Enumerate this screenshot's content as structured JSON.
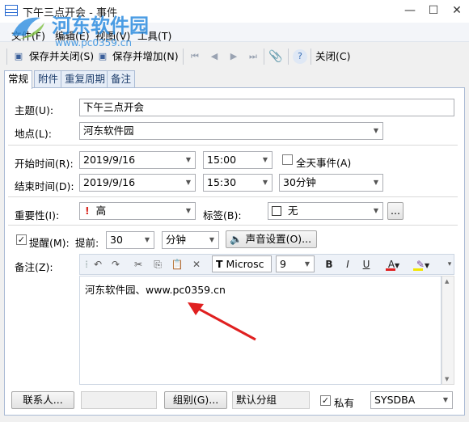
{
  "window": {
    "title": "下午三点开会 - 事件",
    "minimize": "—",
    "maximize": "☐",
    "close": "✕"
  },
  "watermark": {
    "text": "河东软件园",
    "url": "www.pc0359.cn"
  },
  "menu": [
    "文件(F)",
    "编辑(E)",
    "视图(V)",
    "工具(T)"
  ],
  "toolbar": {
    "save_close": "保存并关闭(S)",
    "save_add": "保存并增加(N)",
    "close": "关闭(C)"
  },
  "tabs": [
    "常规",
    "附件",
    "重复周期",
    "备注"
  ],
  "form": {
    "subject_label": "主题(U):",
    "subject_value": "下午三点开会",
    "location_label": "地点(L):",
    "location_value": "河东软件园",
    "start_label": "开始时间(R):",
    "start_date": "2019/9/16",
    "start_time": "15:00",
    "allday_label": "全天事件(A)",
    "end_label": "结束时间(D):",
    "end_date": "2019/9/16",
    "end_time": "15:30",
    "duration": "30分钟",
    "importance_label": "重要性(I):",
    "importance_value": "高",
    "tag_label": "标签(B):",
    "tag_value": "无",
    "tag_more": "...",
    "reminder_label": "提醒(M):",
    "ahead_label": "提前:",
    "ahead_value": "30",
    "ahead_unit": "分钟",
    "sound_button": "声音设置(O)...",
    "notes_label": "备注(Z):",
    "font_name": "Microsc",
    "font_size": "9",
    "note_text": "河东软件园、www.pc0359.cn"
  },
  "footer": {
    "contacts_button": "联系人...",
    "contacts_value": "",
    "group_button": "组别(G)...",
    "group_value": "默认分组",
    "private_label": "私有",
    "owner_value": "SYSDBA"
  },
  "colors": {
    "accent": "#2d8de0",
    "arrow": "#e02020",
    "tab_border": "#a9bad4"
  }
}
